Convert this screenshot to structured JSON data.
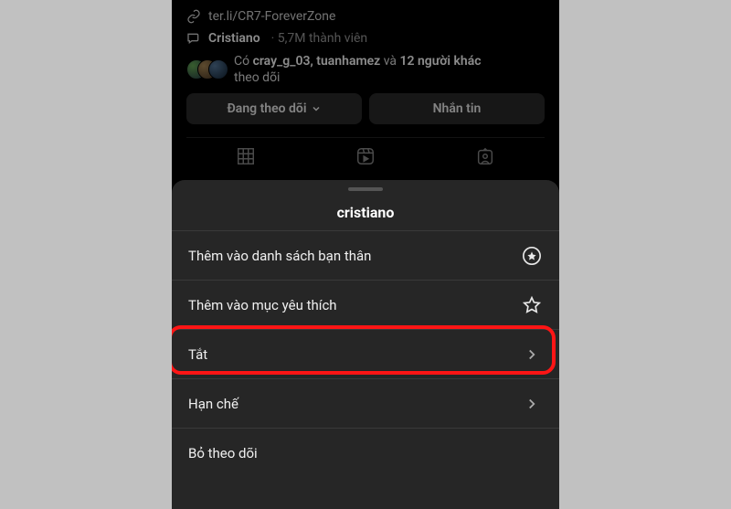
{
  "profile": {
    "link_text": "ter.li/CR7-ForeverZone",
    "channel_name": "Cristiano",
    "channel_members": "5,7M thành viên",
    "followers_prefix": "Có ",
    "followers_names": "cray_g_03, tuanhamez",
    "followers_mid": " và ",
    "followers_count": "12 người khác",
    "followers_suffix": "theo dõi",
    "following_button": "Đang theo dõi",
    "message_button": "Nhắn tin"
  },
  "sheet": {
    "title": "cristiano",
    "rows": {
      "close_friends": "Thêm vào danh sách bạn thân",
      "favorites": "Thêm vào mục yêu thích",
      "mute": "Tắt",
      "restrict": "Hạn chế",
      "unfollow": "Bỏ theo dõi"
    }
  },
  "highlight_target": "mute"
}
